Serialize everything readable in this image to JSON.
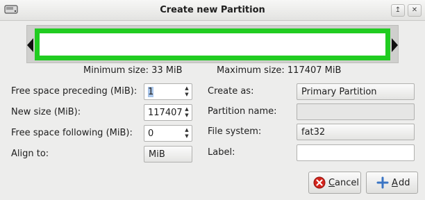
{
  "window": {
    "title": "Create new Partition",
    "controls": [
      "restore",
      "close"
    ]
  },
  "colors": {
    "partition_border": "#21cc21",
    "cancel_icon": "#d4241c",
    "add_icon": "#3a74c4"
  },
  "sizes": {
    "minimum": "Minimum size: 33 MiB",
    "maximum": "Maximum size: 117407 MiB"
  },
  "form": {
    "free_before": {
      "label": "Free space preceding (MiB):",
      "value": "1"
    },
    "new_size": {
      "label": "New size (MiB):",
      "value": "117407"
    },
    "free_after": {
      "label": "Free space following (MiB):",
      "value": "0"
    },
    "align": {
      "label": "Align to:",
      "value": "MiB"
    },
    "create_as": {
      "label": "Create as:",
      "value": "Primary Partition"
    },
    "partition_name": {
      "label": "Partition name:",
      "value": ""
    },
    "file_system": {
      "label": "File system:",
      "value": "fat32"
    },
    "fs_label": {
      "label": "Label:",
      "value": ""
    }
  },
  "buttons": {
    "cancel": {
      "mnemonic": "C",
      "rest": "ancel",
      "icon": "cancel-icon"
    },
    "add": {
      "mnemonic": "A",
      "rest": "dd",
      "icon": "add-icon"
    }
  }
}
